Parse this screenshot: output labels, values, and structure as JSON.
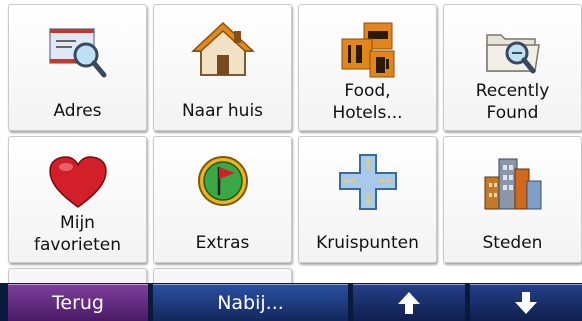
{
  "tiles": [
    {
      "label": "Adres",
      "icon": "address-envelope-icon"
    },
    {
      "label": "Naar huis",
      "icon": "home-icon"
    },
    {
      "label": "Food,\nHotels...",
      "icon": "food-hotels-icon"
    },
    {
      "label": "Recently\nFound",
      "icon": "recently-found-folder-icon"
    },
    {
      "label": "Mijn\nfavorieten",
      "icon": "heart-icon"
    },
    {
      "label": "Extras",
      "icon": "flag-extras-icon"
    },
    {
      "label": "Kruispunten",
      "icon": "intersection-icon"
    },
    {
      "label": "Steden",
      "icon": "city-buildings-icon"
    }
  ],
  "bottom_bar": {
    "back_label": "Terug",
    "near_label": "Nabij...",
    "up_icon": "arrow-up-icon",
    "down_icon": "arrow-down-icon"
  },
  "colors": {
    "back_button": "#5e2a7e",
    "nav_button": "#1d3a80",
    "bar_background": "#0a1a3a"
  }
}
